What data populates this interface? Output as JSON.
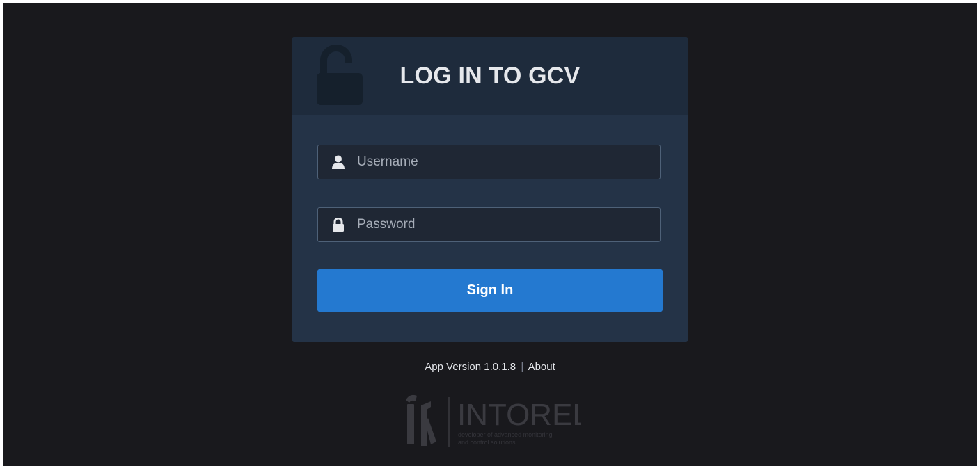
{
  "login": {
    "title": "LOG IN TO GCV",
    "icon": "lock-open-icon",
    "username": {
      "placeholder": "Username",
      "value": "",
      "icon": "user-icon"
    },
    "password": {
      "placeholder": "Password",
      "value": "",
      "icon": "lock-icon"
    },
    "submit_label": "Sign In"
  },
  "footer": {
    "version_text": "App Version 1.0.1.8",
    "separator": "|",
    "about_label": "About",
    "logo": {
      "name": "INTOREL",
      "tagline_line1": "developer of advanced monitoring",
      "tagline_line2": "and control solutions"
    }
  },
  "colors": {
    "background": "#19191d",
    "card": "#243347",
    "card_header": "#1e2b3c",
    "accent": "#2479d0"
  }
}
